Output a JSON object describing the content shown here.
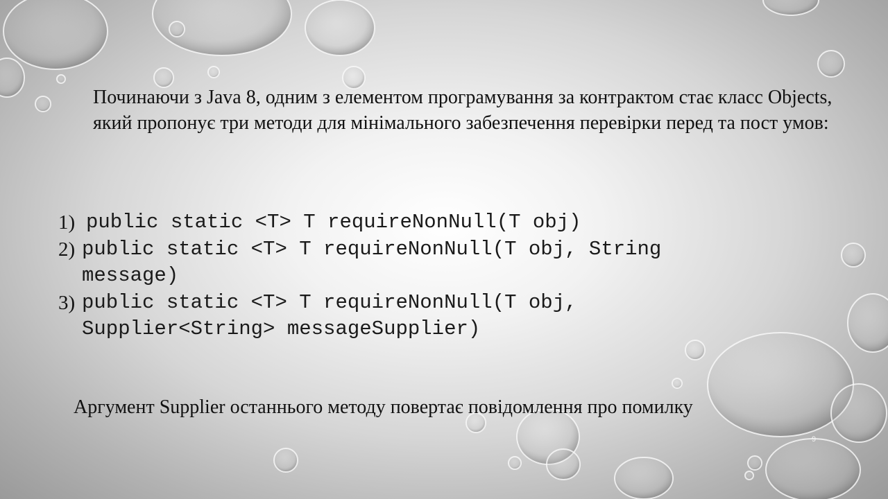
{
  "slide": {
    "intro_text": "Починаючи з Java 8, одним з елементом програмування за контрактом стає класс Objects, який пропонує три методи для мінімального забезпечення перевірки перед та пост умов:",
    "methods": [
      {
        "number": "1)",
        "code": "public static <T> T requireNonNull(T obj)"
      },
      {
        "number": "2)",
        "code": "public static <T> T requireNonNull(T obj, String message)"
      },
      {
        "number": "3)",
        "code": "public static <T> T requireNonNull(T obj, Supplier<String> messageSupplier)"
      }
    ],
    "summary_text": "Аргумент Supplier останнього методу повертає повідомлення про помилку",
    "page_number": "9"
  }
}
